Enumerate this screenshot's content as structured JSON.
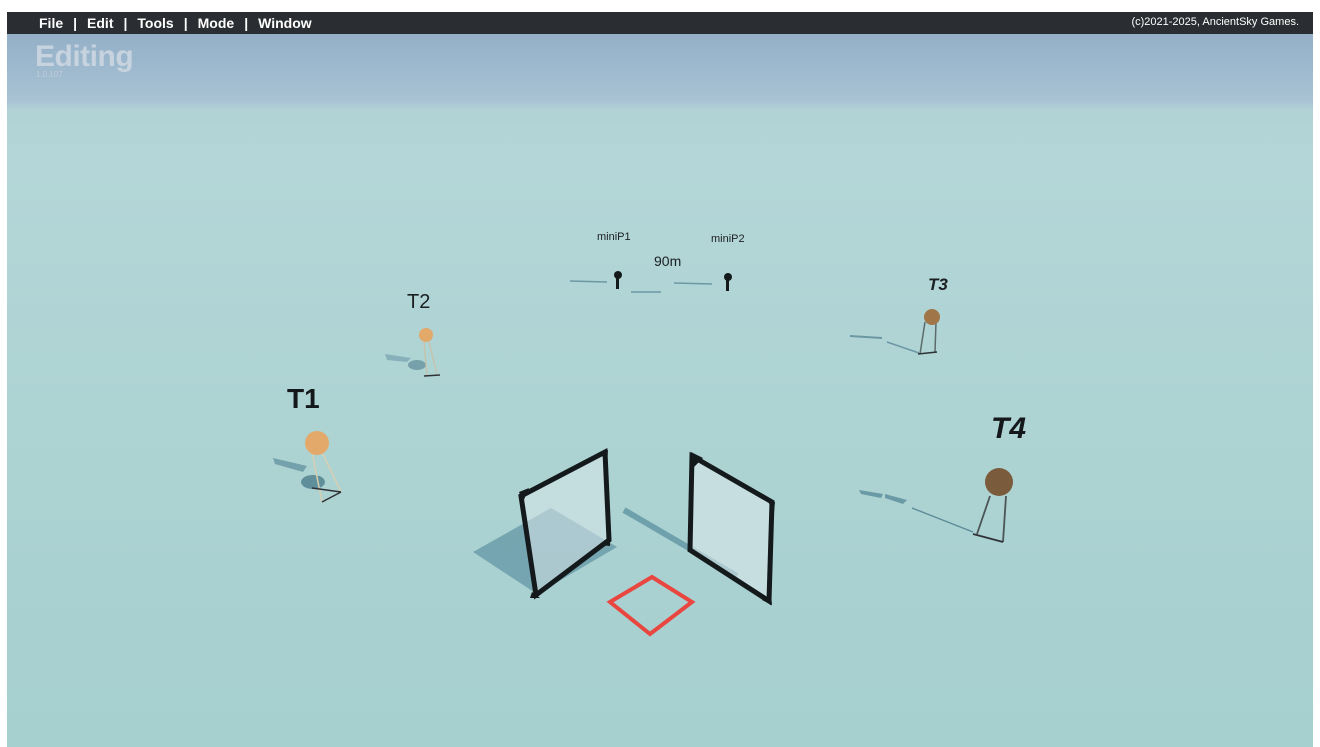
{
  "menu": {
    "items": [
      "File",
      "Edit",
      "Tools",
      "Mode",
      "Window"
    ],
    "separator": "|"
  },
  "copyright": "(c)2021-2025, AncientSky Games.",
  "mode": {
    "title": "Editing",
    "version": "1.0.107"
  },
  "scene": {
    "targets": [
      {
        "label": "T1"
      },
      {
        "label": "T2"
      },
      {
        "label": "T3"
      },
      {
        "label": "T4"
      }
    ],
    "mini_posts": [
      {
        "label": "miniP1"
      },
      {
        "label": "miniP2"
      }
    ],
    "distance_label": "90m",
    "colors": {
      "ground": "#aed3d3",
      "sky": "#8fa9c2",
      "menu_bar": "#2a2d31",
      "shooter_box": "#e8463f",
      "frame": "#14191c",
      "target_light": "#e2a96b",
      "target_dark": "#7a5b3c"
    }
  }
}
